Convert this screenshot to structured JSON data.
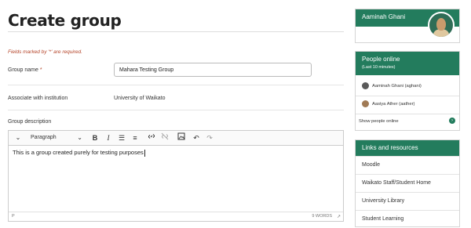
{
  "page": {
    "title": "Create group",
    "required_note": "Fields marked by '*' are required."
  },
  "form": {
    "group_name_label": "Group name",
    "required_star": "*",
    "group_name_value": "Mahara Testing Group",
    "institution_label": "Associate with institution",
    "institution_value": "University of Waikato",
    "description_label": "Group description"
  },
  "editor": {
    "format_value": "Paragraph",
    "content": "This is a group created purely for testing purposes",
    "status_path": "P",
    "word_count": "9 WORDS"
  },
  "sidebar": {
    "user_name": "Aaminah Ghani",
    "online": {
      "title": "People online",
      "subtitle": "(Last 10 minutes)",
      "people": [
        "Aaminah Ghani (aghani)",
        "Aasiya Ather (aather)"
      ],
      "show_link": "Show people online"
    },
    "links": {
      "title": "Links and resources",
      "items": [
        "Moodle",
        "Waikato Staff/Student Home",
        "University Library",
        "Student Learning"
      ]
    }
  },
  "colors": {
    "accent": "#237c5d",
    "required": "#b5452a"
  }
}
